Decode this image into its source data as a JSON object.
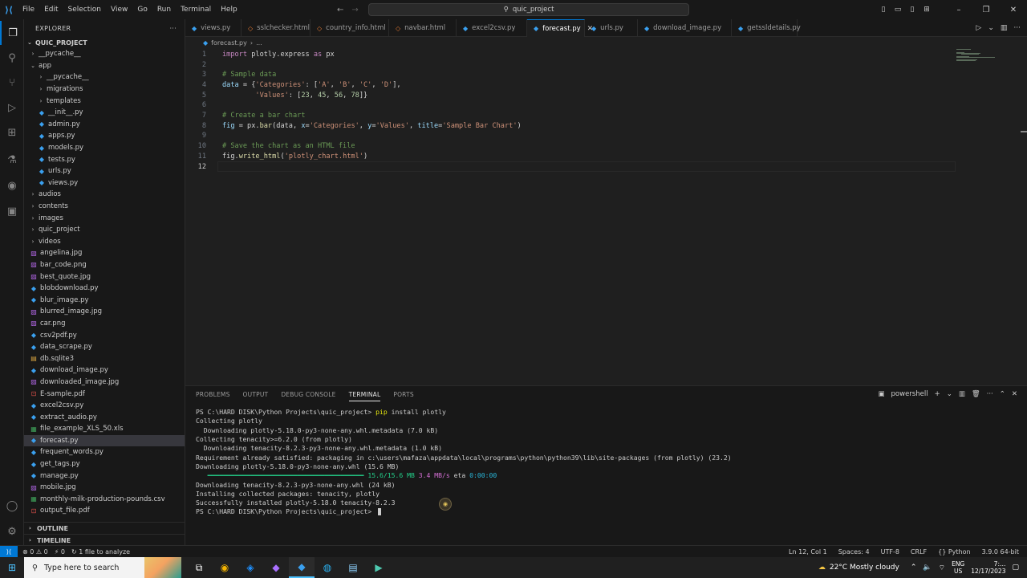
{
  "titlebar": {
    "menu": [
      "File",
      "Edit",
      "Selection",
      "View",
      "Go",
      "Run",
      "Terminal",
      "Help"
    ],
    "search_text": "quic_project"
  },
  "sidebar": {
    "header": "EXPLORER",
    "project": "QUIC_PROJECT",
    "items": [
      {
        "label": "__pycache__",
        "type": "folder",
        "indent": 1,
        "expanded": false
      },
      {
        "label": "app",
        "type": "folder",
        "indent": 1,
        "expanded": true
      },
      {
        "label": "__pycache__",
        "type": "folder",
        "indent": 2,
        "expanded": false
      },
      {
        "label": "migrations",
        "type": "folder",
        "indent": 2,
        "expanded": false
      },
      {
        "label": "templates",
        "type": "folder",
        "indent": 2,
        "expanded": false
      },
      {
        "label": "__init__.py",
        "type": "py",
        "indent": 2
      },
      {
        "label": "admin.py",
        "type": "py",
        "indent": 2
      },
      {
        "label": "apps.py",
        "type": "py",
        "indent": 2
      },
      {
        "label": "models.py",
        "type": "py",
        "indent": 2
      },
      {
        "label": "tests.py",
        "type": "py",
        "indent": 2
      },
      {
        "label": "urls.py",
        "type": "py",
        "indent": 2
      },
      {
        "label": "views.py",
        "type": "py",
        "indent": 2
      },
      {
        "label": "audios",
        "type": "folder",
        "indent": 1,
        "expanded": false
      },
      {
        "label": "contents",
        "type": "folder",
        "indent": 1,
        "expanded": false
      },
      {
        "label": "images",
        "type": "folder",
        "indent": 1,
        "expanded": false
      },
      {
        "label": "quic_project",
        "type": "folder",
        "indent": 1,
        "expanded": false
      },
      {
        "label": "videos",
        "type": "folder",
        "indent": 1,
        "expanded": false
      },
      {
        "label": "angelina.jpg",
        "type": "img",
        "indent": 1
      },
      {
        "label": "bar_code.png",
        "type": "img",
        "indent": 1
      },
      {
        "label": "best_quote.jpg",
        "type": "img",
        "indent": 1
      },
      {
        "label": "blobdownload.py",
        "type": "py",
        "indent": 1
      },
      {
        "label": "blur_image.py",
        "type": "py",
        "indent": 1
      },
      {
        "label": "blurred_image.jpg",
        "type": "img",
        "indent": 1
      },
      {
        "label": "car.png",
        "type": "img",
        "indent": 1
      },
      {
        "label": "csv2pdf.py",
        "type": "py",
        "indent": 1
      },
      {
        "label": "data_scrape.py",
        "type": "py",
        "indent": 1
      },
      {
        "label": "db.sqlite3",
        "type": "db",
        "indent": 1
      },
      {
        "label": "download_image.py",
        "type": "py",
        "indent": 1
      },
      {
        "label": "downloaded_image.jpg",
        "type": "img",
        "indent": 1
      },
      {
        "label": "E-sample.pdf",
        "type": "pdf",
        "indent": 1
      },
      {
        "label": "excel2csv.py",
        "type": "py",
        "indent": 1
      },
      {
        "label": "extract_audio.py",
        "type": "py",
        "indent": 1
      },
      {
        "label": "file_example_XLS_50.xls",
        "type": "xls",
        "indent": 1
      },
      {
        "label": "forecast.py",
        "type": "py",
        "indent": 1,
        "selected": true
      },
      {
        "label": "frequent_words.py",
        "type": "py",
        "indent": 1
      },
      {
        "label": "get_tags.py",
        "type": "py",
        "indent": 1
      },
      {
        "label": "manage.py",
        "type": "py",
        "indent": 1
      },
      {
        "label": "mobile.jpg",
        "type": "img",
        "indent": 1
      },
      {
        "label": "monthly-milk-production-pounds.csv",
        "type": "csv",
        "indent": 1
      },
      {
        "label": "output_file.pdf",
        "type": "pdf",
        "indent": 1
      }
    ],
    "outline": "OUTLINE",
    "timeline": "TIMELINE"
  },
  "tabs": [
    {
      "label": "views.py",
      "active": false
    },
    {
      "label": "sslchecker.html",
      "active": false
    },
    {
      "label": "country_info.html",
      "active": false
    },
    {
      "label": "navbar.html",
      "active": false
    },
    {
      "label": "excel2csv.py",
      "active": false
    },
    {
      "label": "forecast.py",
      "active": true
    },
    {
      "label": "urls.py",
      "active": false
    },
    {
      "label": "download_image.py",
      "active": false
    },
    {
      "label": "getssldetails.py",
      "active": false
    }
  ],
  "breadcrumb": {
    "file": "forecast.py",
    "rest": "..."
  },
  "editor": {
    "lines": [
      [
        {
          "t": "import",
          "c": "kw"
        },
        {
          "t": " plotly.express ",
          "c": "op"
        },
        {
          "t": "as",
          "c": "kw"
        },
        {
          "t": " px",
          "c": "op"
        }
      ],
      [],
      [
        {
          "t": "# Sample data",
          "c": "cm"
        }
      ],
      [
        {
          "t": "data",
          "c": "vr"
        },
        {
          "t": " = {",
          "c": "op"
        },
        {
          "t": "'Categories'",
          "c": "st"
        },
        {
          "t": ": [",
          "c": "op"
        },
        {
          "t": "'A'",
          "c": "st"
        },
        {
          "t": ", ",
          "c": "op"
        },
        {
          "t": "'B'",
          "c": "st"
        },
        {
          "t": ", ",
          "c": "op"
        },
        {
          "t": "'C'",
          "c": "st"
        },
        {
          "t": ", ",
          "c": "op"
        },
        {
          "t": "'D'",
          "c": "st"
        },
        {
          "t": "],",
          "c": "op"
        }
      ],
      [
        {
          "t": "        ",
          "c": "op"
        },
        {
          "t": "'Values'",
          "c": "st"
        },
        {
          "t": ": [",
          "c": "op"
        },
        {
          "t": "23",
          "c": "nm"
        },
        {
          "t": ", ",
          "c": "op"
        },
        {
          "t": "45",
          "c": "nm"
        },
        {
          "t": ", ",
          "c": "op"
        },
        {
          "t": "56",
          "c": "nm"
        },
        {
          "t": ", ",
          "c": "op"
        },
        {
          "t": "78",
          "c": "nm"
        },
        {
          "t": "]}",
          "c": "op"
        }
      ],
      [],
      [
        {
          "t": "# Create a bar chart",
          "c": "cm"
        }
      ],
      [
        {
          "t": "fig",
          "c": "vr"
        },
        {
          "t": " = px.",
          "c": "op"
        },
        {
          "t": "bar",
          "c": "fn"
        },
        {
          "t": "(data, ",
          "c": "op"
        },
        {
          "t": "x",
          "c": "vr"
        },
        {
          "t": "=",
          "c": "op"
        },
        {
          "t": "'Categories'",
          "c": "st"
        },
        {
          "t": ", ",
          "c": "op"
        },
        {
          "t": "y",
          "c": "vr"
        },
        {
          "t": "=",
          "c": "op"
        },
        {
          "t": "'Values'",
          "c": "st"
        },
        {
          "t": ", ",
          "c": "op"
        },
        {
          "t": "title",
          "c": "vr"
        },
        {
          "t": "=",
          "c": "op"
        },
        {
          "t": "'Sample Bar Chart'",
          "c": "st"
        },
        {
          "t": ")",
          "c": "op"
        }
      ],
      [],
      [
        {
          "t": "# Save the chart as an HTML file",
          "c": "cm"
        }
      ],
      [
        {
          "t": "fig.",
          "c": "op"
        },
        {
          "t": "write_html",
          "c": "fn"
        },
        {
          "t": "(",
          "c": "op"
        },
        {
          "t": "'plotly_chart.html'",
          "c": "st"
        },
        {
          "t": ")",
          "c": "op"
        }
      ],
      []
    ],
    "current_line": 12
  },
  "panel": {
    "tabs": [
      "PROBLEMS",
      "OUTPUT",
      "DEBUG CONSOLE",
      "TERMINAL",
      "PORTS"
    ],
    "active_tab": "TERMINAL",
    "shell": "powershell",
    "terminal": [
      [
        {
          "t": "PS C:\\HARD DISK\\Python Projects\\quic_project> ",
          "c": ""
        },
        {
          "t": "pip",
          "c": "tcmd"
        },
        {
          "t": " install plotly",
          "c": "tflag"
        }
      ],
      [
        {
          "t": "Collecting plotly",
          "c": ""
        }
      ],
      [
        {
          "t": "  Downloading plotly-5.18.0-py3-none-any.whl.metadata (7.0 kB)",
          "c": ""
        }
      ],
      [
        {
          "t": "Collecting tenacity>=6.2.0 (from plotly)",
          "c": ""
        }
      ],
      [
        {
          "t": "  Downloading tenacity-8.2.3-py3-none-any.whl.metadata (1.0 kB)",
          "c": ""
        }
      ],
      [
        {
          "t": "Requirement already satisfied: packaging in c:\\users\\mafaza\\appdata\\local\\programs\\python\\python39\\lib\\site-packages (from plotly) (23.2)",
          "c": ""
        }
      ],
      [
        {
          "t": "Downloading plotly-5.18.0-py3-none-any.whl (15.6 MB)",
          "c": ""
        }
      ],
      [
        {
          "t": "   ━━━━━━━━━━━━━━━━━━━━━━━━━━━━━━━━━━━━━━━━ ",
          "c": "pbar"
        },
        {
          "t": "15.6/15.6 MB",
          "c": "pgreen"
        },
        {
          "t": " ",
          "c": ""
        },
        {
          "t": "3.4 MB/s",
          "c": "pmag"
        },
        {
          "t": " eta ",
          "c": ""
        },
        {
          "t": "0:00:00",
          "c": "pcyan"
        }
      ],
      [
        {
          "t": "Downloading tenacity-8.2.3-py3-none-any.whl (24 kB)",
          "c": ""
        }
      ],
      [
        {
          "t": "Installing collected packages: tenacity, plotly",
          "c": ""
        }
      ],
      [
        {
          "t": "Successfully installed plotly-5.18.0 tenacity-8.2.3",
          "c": ""
        }
      ],
      [
        {
          "t": "PS C:\\HARD DISK\\Python Projects\\quic_project> ",
          "c": ""
        }
      ]
    ]
  },
  "statusbar": {
    "errors": "0",
    "warnings": "0",
    "ports": "0",
    "analyze": "1 file to analyze",
    "position": "Ln 12, Col 1",
    "spaces": "Spaces: 4",
    "encoding": "UTF-8",
    "eol": "CRLF",
    "language": "Python",
    "interpreter": "3.9.0 64-bit"
  },
  "taskbar": {
    "search_placeholder": "Type here to search",
    "weather": "22°C  Mostly cloudy",
    "lang_top": "ENG",
    "lang_bottom": "US",
    "time": "7:…",
    "date": "12/17/2023"
  },
  "colors": {
    "accent": "#0078d4",
    "editor_bg": "#1f1f1f",
    "sidebar_bg": "#181818"
  }
}
